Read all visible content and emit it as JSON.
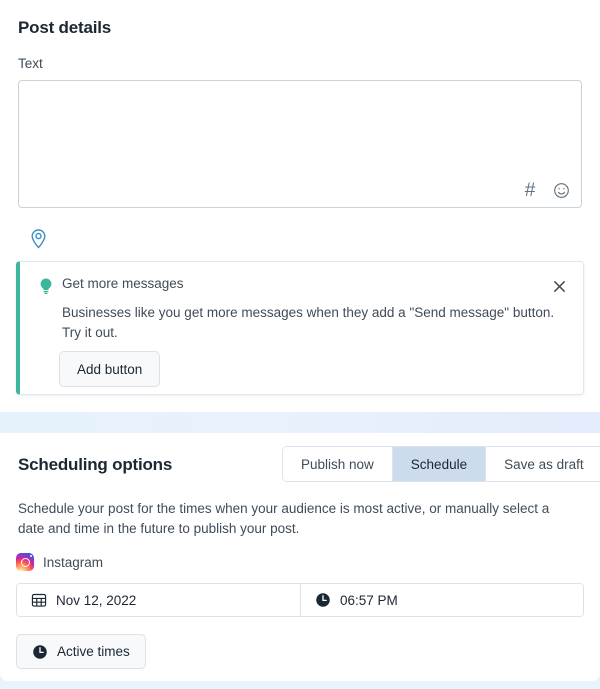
{
  "post_details": {
    "title": "Post details",
    "text_label": "Text",
    "textarea_value": "",
    "textarea_placeholder": "",
    "tools": [
      {
        "name": "hashtag-icon",
        "glyph": "#"
      },
      {
        "name": "emoji-icon",
        "glyph": "☺"
      }
    ],
    "location_icon": "location-pin-icon"
  },
  "tip_banner": {
    "icon": "lightbulb-icon",
    "title": "Get more messages",
    "body": "Businesses like you get more messages when they add a \"Send message\" button. Try it out.",
    "action_label": "Add button",
    "close_icon": "close-icon",
    "accent_color": "#3cb79b"
  },
  "scheduling": {
    "title": "Scheduling options",
    "modes": [
      {
        "label": "Publish now",
        "selected": false
      },
      {
        "label": "Schedule",
        "selected": true
      },
      {
        "label": "Save as draft",
        "selected": false
      }
    ],
    "selected_mode": "Schedule",
    "description": "Schedule your post for the times when your audience is most active, or manually select a date and time in the future to publish your post.",
    "network": {
      "icon": "instagram-icon",
      "label": "Instagram"
    },
    "date": {
      "icon": "calendar-icon",
      "value": "Nov 12, 2022"
    },
    "time": {
      "icon": "clock-icon",
      "value": "06:57 PM"
    },
    "active_times_button": {
      "icon": "clock-icon",
      "label": "Active times"
    }
  },
  "colors": {
    "accent_teal": "#3cb79b",
    "segment_selected_bg": "#ccdced",
    "text_primary": "#1b2733",
    "text_secondary": "#3f4c59",
    "border": "#dbe2e9"
  }
}
